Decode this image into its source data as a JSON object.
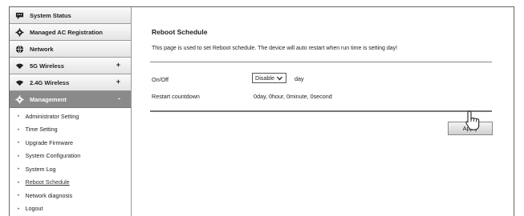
{
  "sidebar": {
    "items": [
      {
        "label": "System Status",
        "icon": "chat-bubble-icon",
        "plus": ""
      },
      {
        "label": "Managed AC Registration",
        "icon": "gear-icon",
        "plus": ""
      },
      {
        "label": "Network",
        "icon": "globe-icon",
        "plus": ""
      },
      {
        "label": "5G Wireless",
        "icon": "wifi-icon",
        "plus": "+"
      },
      {
        "label": "2.4G Wireless",
        "icon": "wifi-icon",
        "plus": "+"
      },
      {
        "label": "Management",
        "icon": "gear-icon",
        "plus": "-"
      }
    ],
    "submenu": [
      "Administrator Setting",
      "Time Setting",
      "Upgrade Firmware",
      "System Configuration",
      "System Log",
      "Reboot Schedule",
      "Network diagnosis",
      "Logout"
    ],
    "selected_submenu": "Reboot Schedule"
  },
  "main": {
    "title": "Reboot Schedule",
    "description": "This page is used to set Reboot schedule. The device will auto restart when run time is setting day!",
    "onoff": {
      "label": "On/Off",
      "selected": "Disable",
      "unit": "day"
    },
    "countdown": {
      "label": "Restart countdown",
      "value": "0day, 0hour, 0minute, 0second"
    },
    "apply_label": "Apply"
  },
  "colors": {
    "active_menu": "#8a8a8a",
    "menu_gradient_top": "#fafafa",
    "menu_gradient_bottom": "#e4e4e4"
  }
}
